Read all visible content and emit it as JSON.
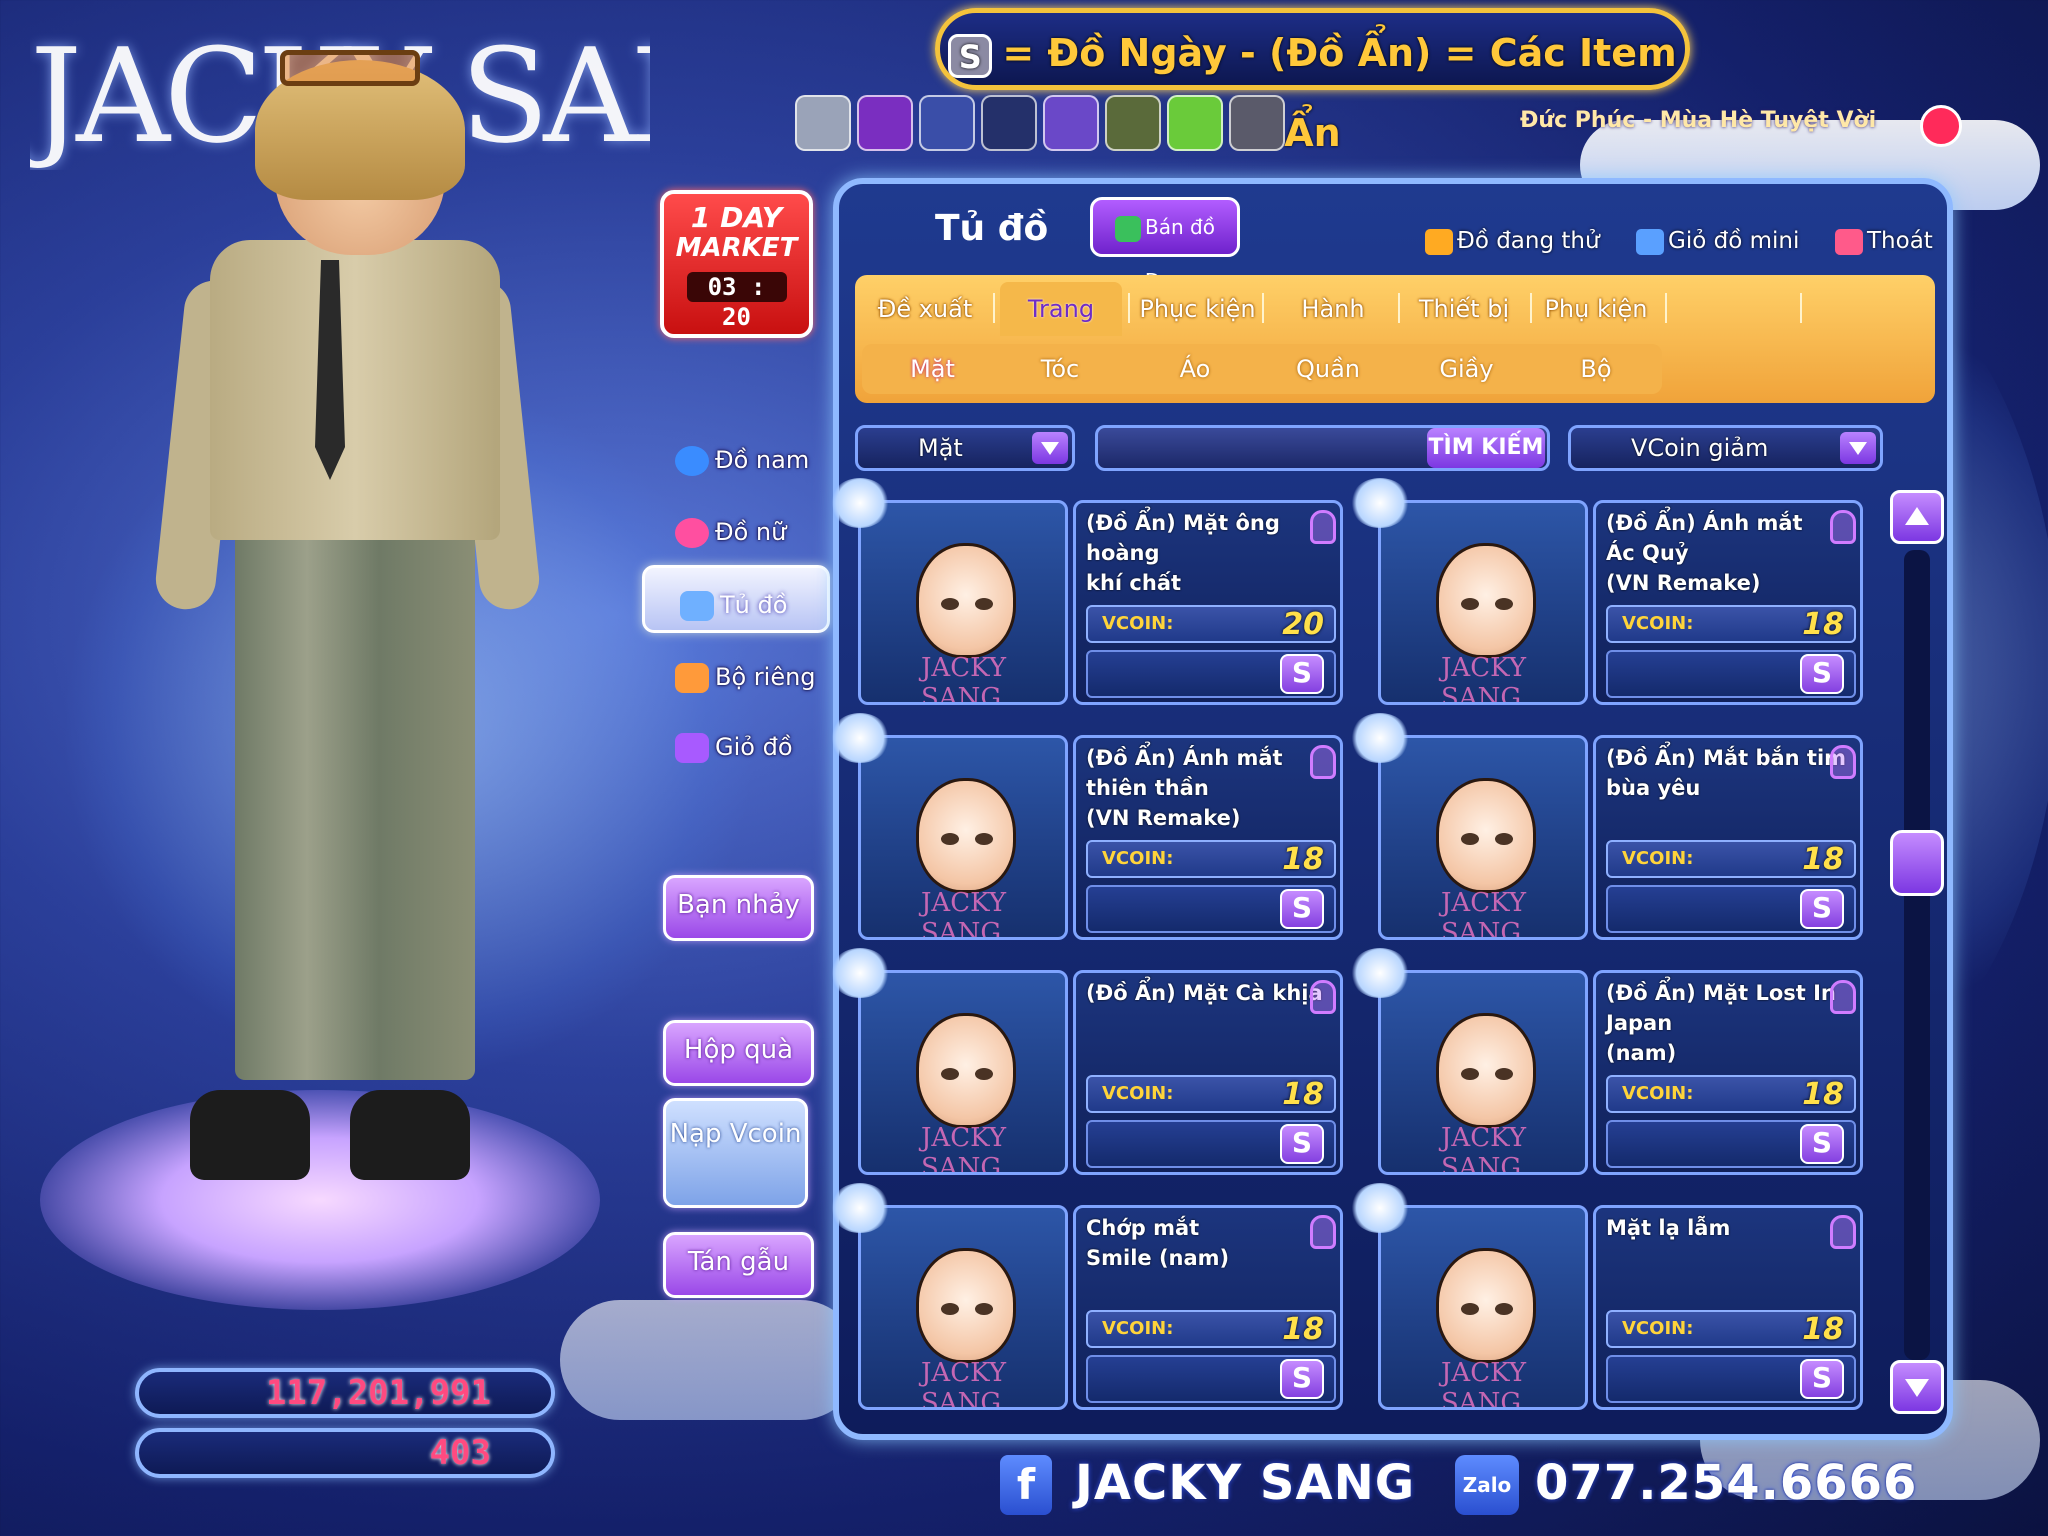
{
  "brand": {
    "left_logo": "JACKY SANG"
  },
  "banner": {
    "icon": "S",
    "text": "= Đồ Ngày - (Đồ Ẩn) = Các Item Ẩn"
  },
  "now_playing": "Đức Phúc - Mùa Hè Tuyệt Vời",
  "market": {
    "line1": "1 DAY",
    "line2": "MARKET",
    "timer": "03 : 20"
  },
  "side_menu": {
    "do_nam": "Đồ nam",
    "do_nu": "Đồ nữ",
    "tu_do": "Tủ đồ",
    "bo_rieng": "Bộ riêng",
    "gio_do": "Giỏ đồ",
    "ban_nhay": "Bạn nhảy",
    "hop_qua": "Hộp quà",
    "nap_vcoin": "Nạp Vcoin",
    "tan_gau": "Tán gẫu"
  },
  "stats": {
    "gold": "117,201,991",
    "vcoin": "403"
  },
  "panel": {
    "title": "Tủ đồ",
    "ban_do_den": "Bán đồ Đen",
    "do_dang_thu": "Đồ đang thử",
    "gio_do_mini": "Giỏ đồ mini",
    "thoat": "Thoát"
  },
  "tabs": [
    "Đề xuất",
    "Trang phục",
    "Phục kiện",
    "Hành động",
    "Thiết bị",
    "Phụ kiện"
  ],
  "subtabs": [
    "Mặt",
    "Tóc",
    "Áo",
    "Quần",
    "Giầy",
    "Bộ"
  ],
  "filters": {
    "category": "Mặt",
    "search_button": "TÌM KIẾM",
    "sort": "VCoin giảm"
  },
  "price_label": "VCOIN:",
  "buy_icon": "S",
  "watermark": "JACKY SANG",
  "items": [
    {
      "name": "(Đồ Ẩn) Mặt ông hoàng\nkhí chất",
      "price": "20"
    },
    {
      "name": "(Đồ Ẩn) Ánh mắt\nÁc Quỷ\n(VN Remake)",
      "price": "18"
    },
    {
      "name": "(Đồ Ẩn) Ánh mắt\nthiên thần\n(VN Remake)",
      "price": "18"
    },
    {
      "name": "(Đồ Ẩn) Mắt bắn tim\nbùa yêu",
      "price": "18"
    },
    {
      "name": "(Đồ Ẩn) Mặt Cà khịa",
      "price": "18"
    },
    {
      "name": "(Đồ Ẩn) Mặt Lost In Japan\n(nam)",
      "price": "18"
    },
    {
      "name": "Chớp mắt\nSmile (nam)",
      "price": "18"
    },
    {
      "name": "Mặt lạ lẫm",
      "price": "18"
    }
  ],
  "credits": {
    "facebook": "JACKY SANG",
    "zalo_label": "Zalo",
    "phone": "077.254.6666"
  },
  "icons": [
    "facebook-icon",
    "zalo-icon",
    "lock-icon",
    "shopping-basket-icon",
    "shirt-icon",
    "exit-door-icon"
  ]
}
